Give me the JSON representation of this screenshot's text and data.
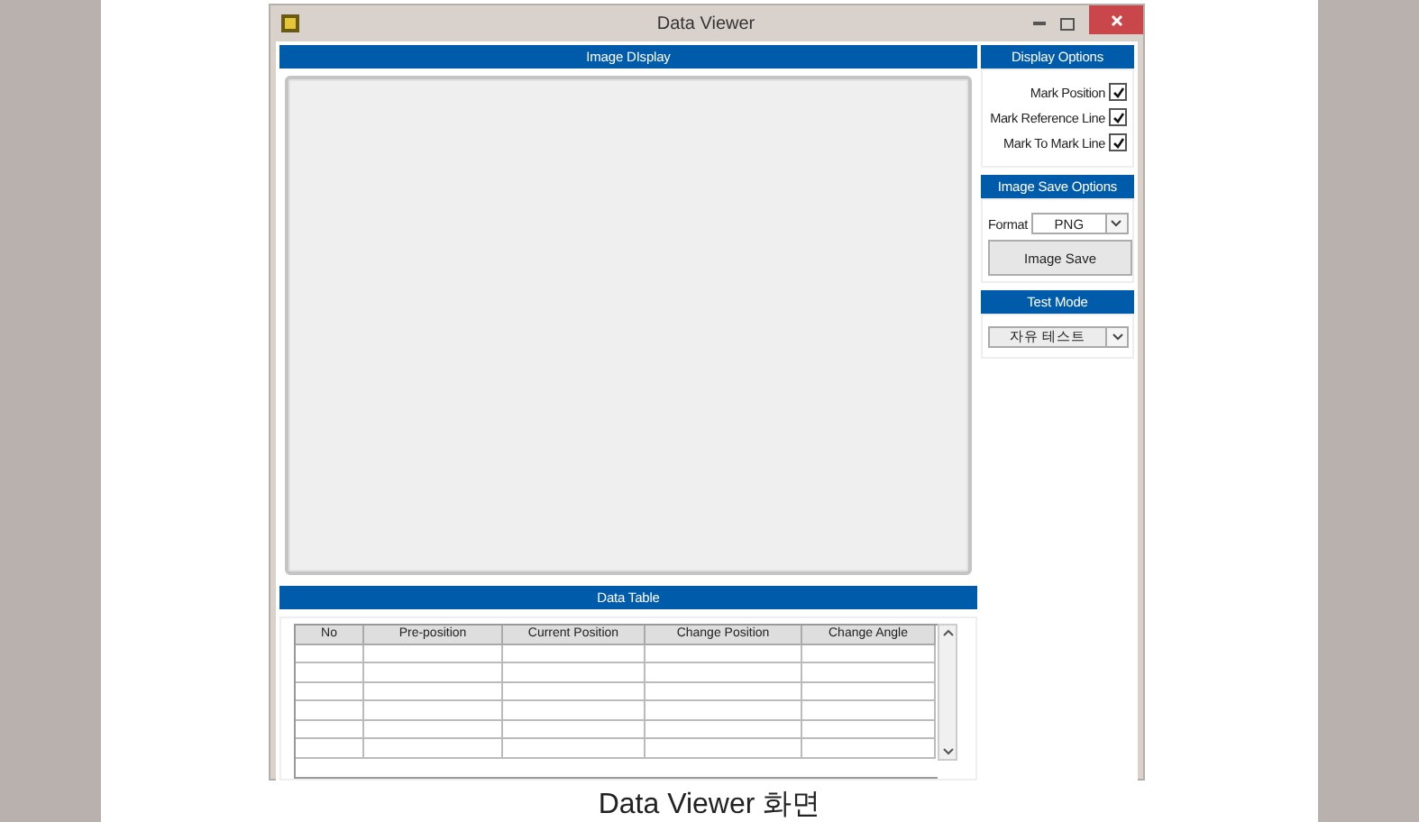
{
  "window": {
    "title": "Data Viewer"
  },
  "image_display": {
    "title": "Image DIsplay"
  },
  "data_table": {
    "title": "Data Table",
    "columns": [
      "No",
      "Pre-position",
      "Current Position",
      "Change Position",
      "Change Angle"
    ]
  },
  "display_options": {
    "title": "Display Options",
    "options": [
      {
        "label": "Mark Position",
        "checked": true
      },
      {
        "label": "Mark Reference Line",
        "checked": true
      },
      {
        "label": "Mark To Mark Line",
        "checked": true
      }
    ]
  },
  "image_save_options": {
    "title": "Image Save Options",
    "format_label": "Format",
    "format_value": "PNG",
    "button": "Image Save"
  },
  "test_mode": {
    "title": "Test Mode",
    "value": "자유 테스트"
  },
  "caption": "Data Viewer 화면"
}
